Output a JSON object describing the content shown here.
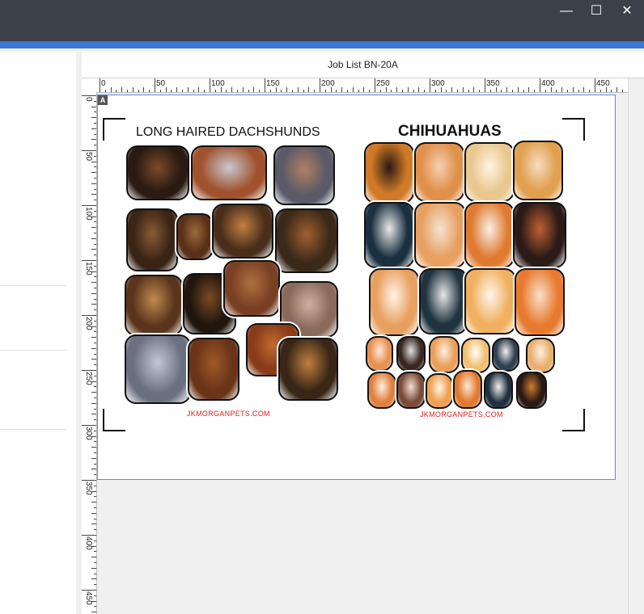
{
  "window": {
    "minimize_glyph": "—",
    "maximize_glyph": "☐",
    "close_glyph": "✕"
  },
  "view": {
    "title": "Job List BN-20A",
    "sheet_badge": "A"
  },
  "ruler": {
    "h_labels": [
      "0",
      "50",
      "100",
      "150",
      "200",
      "250",
      "300",
      "350",
      "400",
      "450"
    ],
    "v_labels": [
      "0",
      "50",
      "100",
      "150",
      "200",
      "250",
      "300",
      "350",
      "400",
      "450"
    ]
  },
  "artwork": {
    "left_heading": "LONG HAIRED DACHSHUNDS",
    "right_heading": "CHIHUAHUAS",
    "left_url": "JKMORGANPETS.COM",
    "right_url": "JKMORGANPETS.COM"
  },
  "colors": {
    "titlebar": "#3c4048",
    "accent": "#3b78d8",
    "sheet_border": "#5b8fd6",
    "url_red": "#e02020"
  }
}
